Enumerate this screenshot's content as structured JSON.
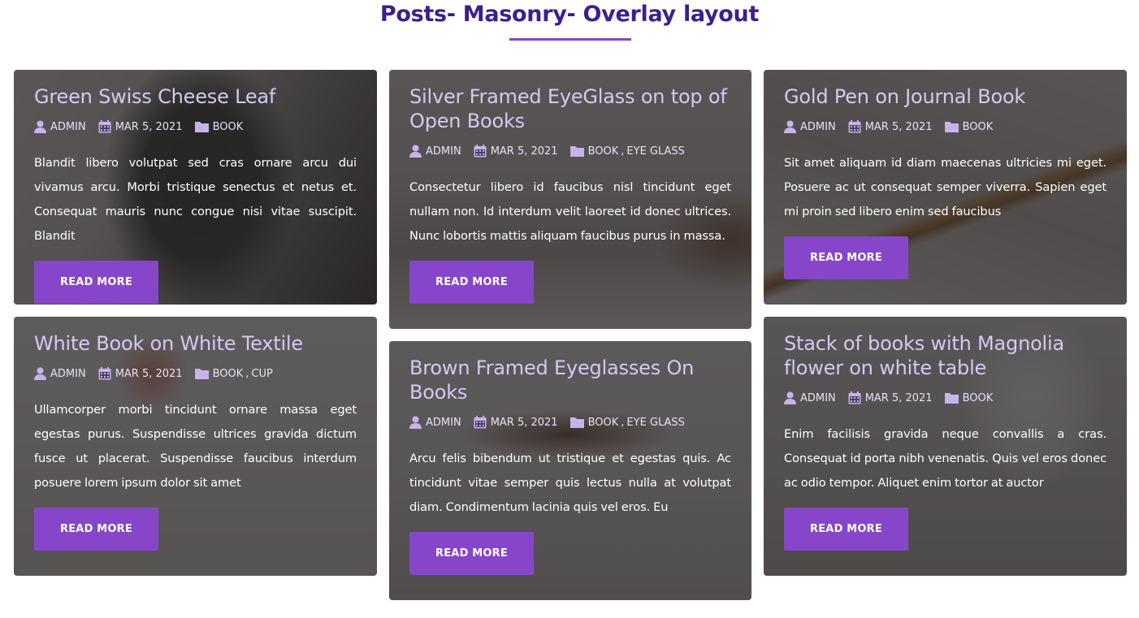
{
  "page": {
    "title": "Posts- Masonry- Overlay layout",
    "accent_color": "#8746c9",
    "title_color": "#3b1f8f"
  },
  "posts": [
    {
      "title": "Green Swiss Cheese Leaf",
      "author": "ADMIN",
      "date": "MAR 5, 2021",
      "categories": [
        "BOOK"
      ],
      "excerpt": "Blandit libero volutpat sed cras ornare arcu dui vivamus arcu. Morbi tristique senectus et netus et. Consequat mauris nunc congue nisi vitae suscipit. Blandit",
      "button": "READ MORE",
      "image": "monstera-leaf-on-books"
    },
    {
      "title": "Silver Framed EyeGlass on top of Open Books",
      "author": "ADMIN",
      "date": "MAR 5, 2021",
      "categories": [
        "BOOK",
        "EYE GLASS"
      ],
      "excerpt": "Consectetur libero id faucibus nisl tincidunt eget nullam non. Id interdum velit laoreet id donec ultrices. Nunc lobortis mattis aliquam faucibus purus in massa.",
      "button": "READ MORE",
      "image": "glasses-on-open-book"
    },
    {
      "title": "Gold Pen on Journal Book",
      "author": "ADMIN",
      "date": "MAR 5, 2021",
      "categories": [
        "BOOK"
      ],
      "excerpt": "Sit amet aliquam id diam maecenas ultricies mi eget. Posuere ac ut consequat semper viverra. Sapien eget mi proin sed libero enim sed faucibus",
      "button": "READ MORE",
      "image": "gold-pen-journal"
    },
    {
      "title": "White Book on White Textile",
      "author": "ADMIN",
      "date": "MAR 5, 2021",
      "categories": [
        "BOOK",
        "CUP"
      ],
      "excerpt": "Ullamcorper morbi tincidunt ornare massa eget egestas purus. Suspendisse ultrices gravida dictum fusce ut placerat. Suspendisse faucibus interdum posuere lorem ipsum dolor sit amet",
      "button": "READ MORE",
      "image": "white-book-textile"
    },
    {
      "title": "Brown Framed Eyeglasses On Books",
      "author": "ADMIN",
      "date": "MAR 5, 2021",
      "categories": [
        "BOOK",
        "EYE GLASS"
      ],
      "excerpt": "Arcu felis bibendum ut tristique et egestas quis. Ac tincidunt vitae semper quis lectus nulla at volutpat diam. Condimentum lacinia quis vel eros. Eu",
      "button": "READ MORE",
      "image": "brown-glasses-on-book-stack"
    },
    {
      "title": "Stack of books with Magnolia flower on white table",
      "author": "ADMIN",
      "date": "MAR 5, 2021",
      "categories": [
        "BOOK"
      ],
      "excerpt": "Enim facilisis gravida neque convallis a cras. Consequat id porta nibh venenatis. Quis vel eros donec ac odio tempor. Aliquet enim tortor at auctor",
      "button": "READ MORE",
      "image": "magnolia-books-stack"
    }
  ]
}
